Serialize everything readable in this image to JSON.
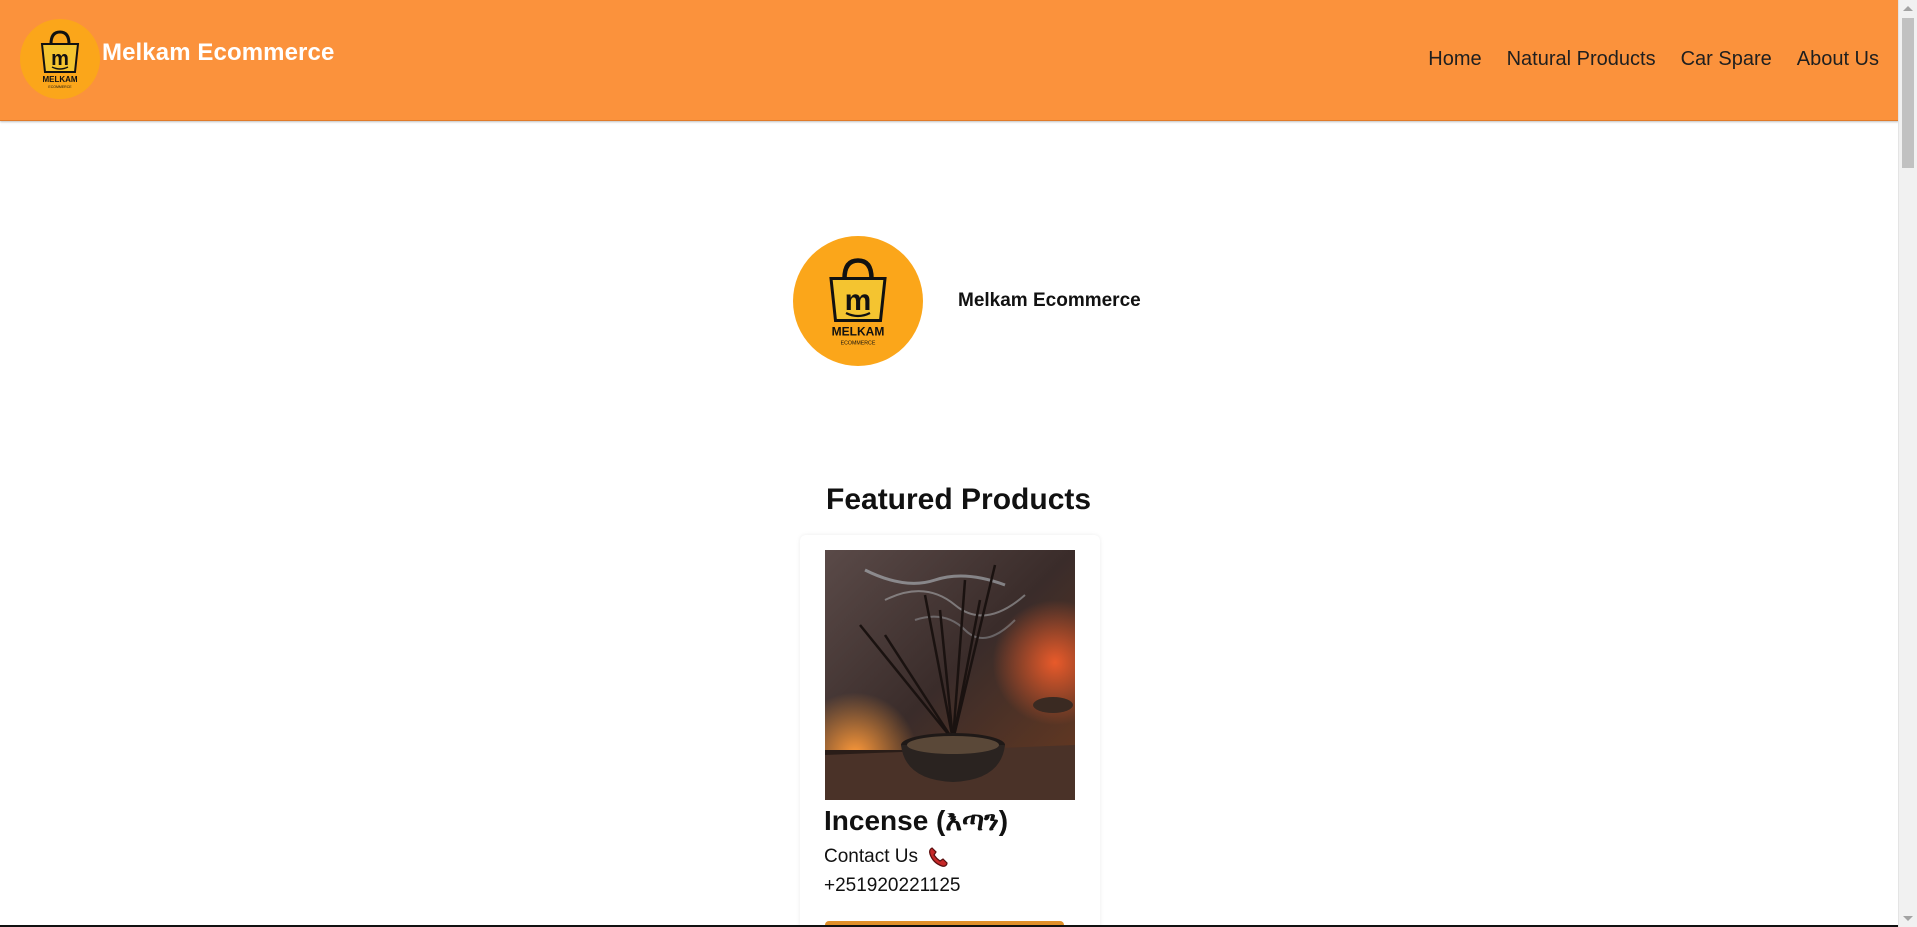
{
  "brand": {
    "name": "Melkam Ecommerce",
    "logo_text": "MELKAM",
    "logo_subtext": "ECOMMERCE"
  },
  "nav": {
    "items": [
      {
        "label": "Home"
      },
      {
        "label": "Natural Products"
      },
      {
        "label": "Car Spare"
      },
      {
        "label": "About Us"
      }
    ]
  },
  "hero": {
    "title": "Melkam Ecommerce"
  },
  "featured": {
    "heading": "Featured Products",
    "products": [
      {
        "title": "Incense (እጣን)",
        "contact_label": "Contact Us",
        "phone": "+251920221125",
        "icon": "phone-icon"
      }
    ]
  },
  "colors": {
    "header_bg": "#fb923c",
    "logo_bg": "#fba61a",
    "button": "#e0902a"
  }
}
